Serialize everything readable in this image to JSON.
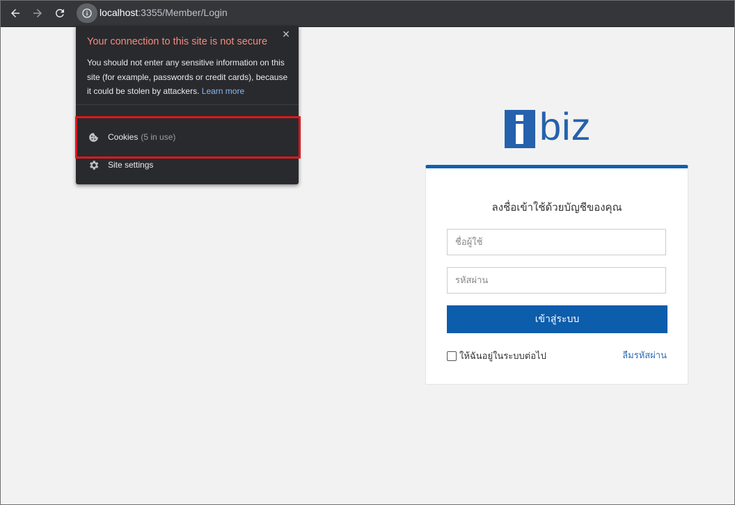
{
  "browser": {
    "url_host": "localhost",
    "url_rest": ":3355/Member/Login",
    "back_icon": "arrow-left-icon",
    "forward_icon": "arrow-right-icon",
    "reload_icon": "reload-icon",
    "site_info_icon": "info-icon"
  },
  "popup": {
    "title": "Your connection to this site is not secure",
    "description": "You should not enter any sensitive information on this site (for example, passwords or credit cards), because it could be stolen by attackers.",
    "learn_more": "Learn more",
    "close_symbol": "✕",
    "cookies_label": "Cookies",
    "cookies_sub": "(5 in use)",
    "site_settings_label": "Site settings",
    "highlight_color": "#e0161c"
  },
  "login": {
    "logo_text": "biz",
    "brand_color": "#2561ad",
    "title": "ลงชื่อเข้าใช้ด้วยบัญชีของคุณ",
    "username_placeholder": "ชื่อผู้ใช้",
    "password_placeholder": "รหัสผ่าน",
    "submit_label": "เข้าสู่ระบบ",
    "remember_label": "ให้ฉันอยู่ในระบบต่อไป",
    "forgot_label": "ลืมรหัสผ่าน",
    "accent_color": "#0f5fae"
  }
}
